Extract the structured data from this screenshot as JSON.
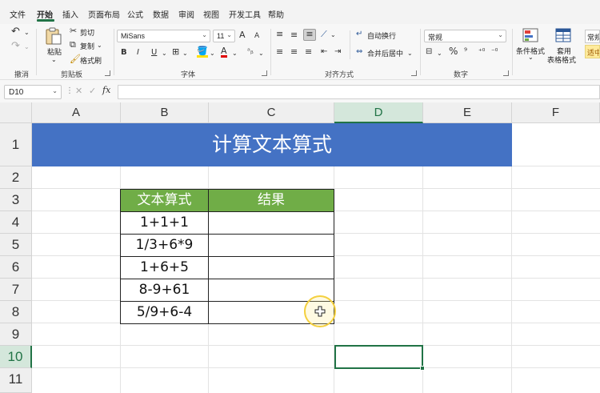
{
  "menu": [
    "文件",
    "开始",
    "插入",
    "页面布局",
    "公式",
    "数据",
    "审阅",
    "视图",
    "开发工具",
    "帮助"
  ],
  "ribbon": {
    "undo_group": "撤消",
    "clipboard": {
      "paste": "粘贴",
      "cut": "剪切",
      "copy": "复制",
      "format_painter": "格式刷",
      "label": "剪贴板"
    },
    "font": {
      "name": "MiSans",
      "size": "11",
      "label": "字体",
      "bold": "B",
      "italic": "I",
      "underline": "U",
      "grow": "A",
      "shrink": "A",
      "font_color": "A"
    },
    "alignment": {
      "wrap": "自动换行",
      "merge": "合并后居中",
      "label": "对齐方式"
    },
    "number": {
      "format": "常规",
      "percent": "%",
      "label": "数字"
    },
    "styles": {
      "conditional": "条件格式",
      "table_line1": "套用",
      "table_line2": "表格格式",
      "style_normal": "常规",
      "style_good": "适中"
    }
  },
  "formula_bar": {
    "name_box": "D10",
    "fx": "fx",
    "value": ""
  },
  "columns": [
    "A",
    "B",
    "C",
    "D",
    "E",
    "F"
  ],
  "rows": [
    "1",
    "2",
    "3",
    "4",
    "5",
    "6",
    "7",
    "8",
    "9",
    "10",
    "11"
  ],
  "sheet": {
    "title": "计算文本算式",
    "table": {
      "headers": [
        "文本算式",
        "结果"
      ],
      "rows": [
        [
          "1+1+1",
          ""
        ],
        [
          "1/3+6*9",
          ""
        ],
        [
          "1+6+5",
          ""
        ],
        [
          "8-9+61",
          ""
        ],
        [
          "5/9+6-4",
          ""
        ]
      ]
    }
  },
  "colors": {
    "accent": "#217346",
    "title_bg": "#4472c4",
    "header_bg": "#70ad47"
  }
}
